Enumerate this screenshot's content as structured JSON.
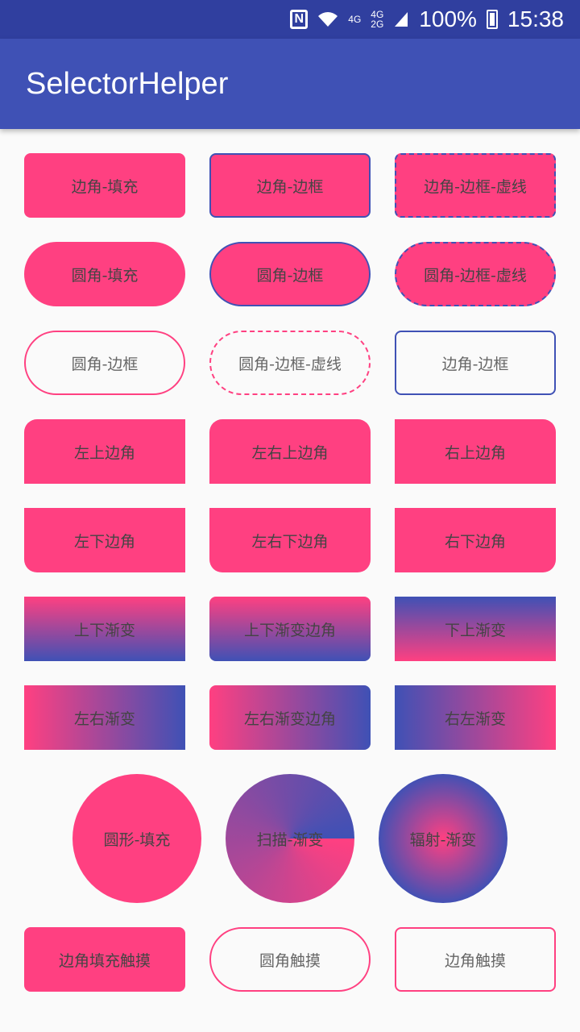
{
  "status": {
    "network1": "4G",
    "network2a": "4G",
    "network2b": "2G",
    "battery": "100%",
    "time": "15:38",
    "nfc": "N"
  },
  "appbar": {
    "title": "SelectorHelper"
  },
  "rows": [
    [
      "边角-填充",
      "边角-边框",
      "边角-边框-虚线"
    ],
    [
      "圆角-填充",
      "圆角-边框",
      "圆角-边框-虚线"
    ],
    [
      "圆角-边框",
      "圆角-边框-虚线",
      "边角-边框"
    ],
    [
      "左上边角",
      "左右上边角",
      "右上边角"
    ],
    [
      "左下边角",
      "左右下边角",
      "右下边角"
    ],
    [
      "上下渐变",
      "上下渐变边角",
      "下上渐变"
    ],
    [
      "左右渐变",
      "左右渐变边角",
      "右左渐变"
    ]
  ],
  "circles": [
    "圆形-填充",
    "扫描-渐变",
    "辐射-渐变"
  ],
  "touch": [
    "边角填充触摸",
    "圆角触摸",
    "边角触摸"
  ],
  "colors": {
    "primary": "#3f51b5",
    "primary_dark": "#303f9f",
    "accent": "#ff4081"
  }
}
